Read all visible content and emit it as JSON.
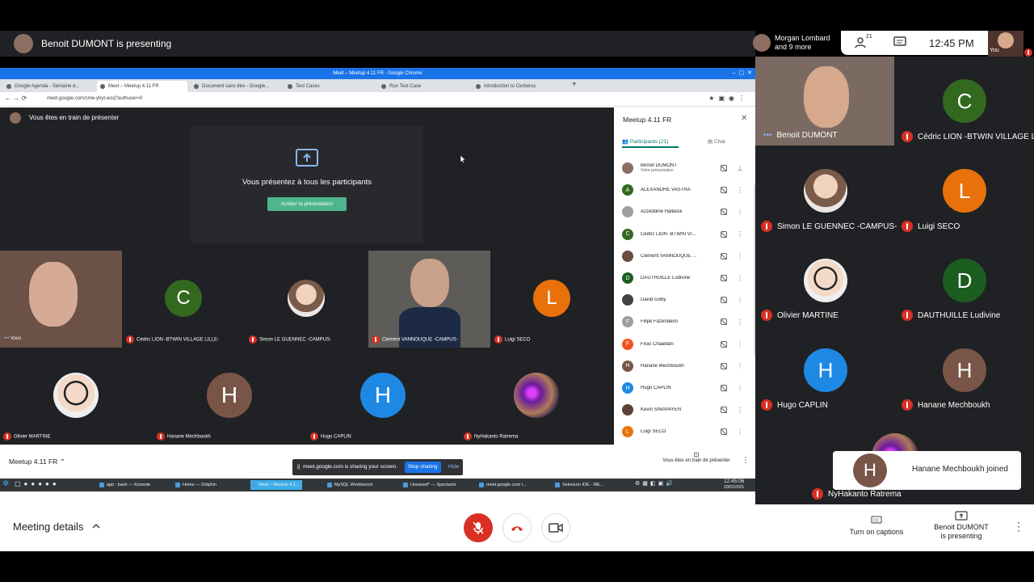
{
  "header": {
    "presenting_text": "Benoit DUMONT is presenting",
    "others_text_1": "Morgan Lombard",
    "others_text_2": "and 9 more",
    "participant_count": "21",
    "time": "12:45 PM",
    "self_label": "You"
  },
  "browser": {
    "title": "Meet – Meetup 4.11 FR - Google Chrome",
    "url": "meet.google.com/cme-ybyt-wsq?authuser=0",
    "tabs": [
      "Google Agenda - Semaine d...",
      "Meet – Meetup 4.11 FR",
      "Document sans titre - Google...",
      "Test Cases",
      "Run Test Case",
      "Introduction to Cerberus"
    ]
  },
  "inner": {
    "presenting_banner": "Vous êtes en train de présenter",
    "present_title": "Vous présentez à tous les participants",
    "stop_button": "Arrêter la présentation",
    "meeting_name": "Meetup 4.11 FR",
    "footer_presenting": "Vous êtes en train de présenter",
    "share_notice": "meet.google.com is sharing your screen.",
    "stop_sharing": "Stop sharing",
    "hide": "Hide",
    "tiles": [
      {
        "name": "Vous"
      },
      {
        "name": "Cédric LION -BTWIN VILLAGE LILLE-",
        "letter": "C",
        "color": "#33691e"
      },
      {
        "name": "Simon LE GUENNEC -CAMPUS-"
      },
      {
        "name": "Clement VANNOUQUE -CAMPUS-"
      },
      {
        "name": "Luigi SECO",
        "letter": "L",
        "color": "#e8710a"
      },
      {
        "name": "Olivier MARTINE"
      },
      {
        "name": "Hanane Mechboukh",
        "letter": "H",
        "color": "#795548"
      },
      {
        "name": "Hugo CAPLIN",
        "letter": "H",
        "color": "#1e88e5"
      },
      {
        "name": "NyHakanto Ratrema"
      }
    ]
  },
  "side_panel": {
    "title": "Meetup 4.11 FR",
    "tab_participants": "Participants (21)",
    "tab_chat": "Chat",
    "participants": [
      {
        "name": "Benoit DUMONT",
        "sub": "Votre présentation",
        "color": "#8d6e63"
      },
      {
        "name": "ALEXANDRE VASTRA",
        "letter": "A",
        "color": "#33691e"
      },
      {
        "name": "Azzeddine Hallaoui",
        "color": "#9e9e9e"
      },
      {
        "name": "Cédric LION -BTWIN VI...",
        "letter": "C",
        "color": "#33691e"
      },
      {
        "name": "Clement VANNOUQUE ...",
        "color": "#6d4c41"
      },
      {
        "name": "DAUTHUILLE Ludivine",
        "letter": "D",
        "color": "#1b5e20"
      },
      {
        "name": "David Goby",
        "color": "#424242"
      },
      {
        "name": "Filipe Fazendeiro",
        "letter": "F",
        "color": "#9e9e9e"
      },
      {
        "name": "Firas Chaabani",
        "letter": "F",
        "color": "#f4511e"
      },
      {
        "name": "Hanane Mechboukh",
        "letter": "H",
        "color": "#795548"
      },
      {
        "name": "Hugo CAPLIN",
        "letter": "H",
        "color": "#1e88e5"
      },
      {
        "name": "Kevin SINAPAYEN",
        "color": "#5d4037"
      },
      {
        "name": "Luigi SECO",
        "letter": "L",
        "color": "#e8710a"
      }
    ]
  },
  "taskbar": {
    "items": [
      "app : bash — Konsole",
      "Home — Dolphin",
      "Meet – Meetup 4.1...",
      "MySQL Workbench",
      "Unsaved* — Spectacle",
      "meet.google.com i...",
      "Selenium IDE - ME..."
    ],
    "time": "12:45:06",
    "date": "20/01/2021"
  },
  "grid": [
    {
      "name": "Benoit DUMONT"
    },
    {
      "name": "Cédric LION -BTWIN VILLAGE LI...",
      "letter": "C",
      "color": "#33691e"
    },
    {
      "name": "Simon LE GUENNEC -CAMPUS-"
    },
    {
      "name": "Luigi SECO",
      "letter": "L",
      "color": "#e8710a"
    },
    {
      "name": "Olivier MARTINE"
    },
    {
      "name": "DAUTHUILLE Ludivine",
      "letter": "D",
      "color": "#1b5e20"
    },
    {
      "name": "Hugo CAPLIN",
      "letter": "H",
      "color": "#1e88e5"
    },
    {
      "name": "Hanane Mechboukh",
      "letter": "H",
      "color": "#795548"
    },
    {
      "name": "NyHakanto Ratrema"
    }
  ],
  "toast": {
    "letter": "H",
    "text": "Hanane Mechboukh joined"
  },
  "bottom": {
    "meeting_details": "Meeting details",
    "captions": "Turn on captions",
    "presenting_1": "Benoit DUMONT",
    "presenting_2": "is presenting"
  },
  "colors": {
    "red": "#d93025",
    "meet_dark": "#202124",
    "blue": "#1a73e8",
    "teal": "#00897b"
  }
}
